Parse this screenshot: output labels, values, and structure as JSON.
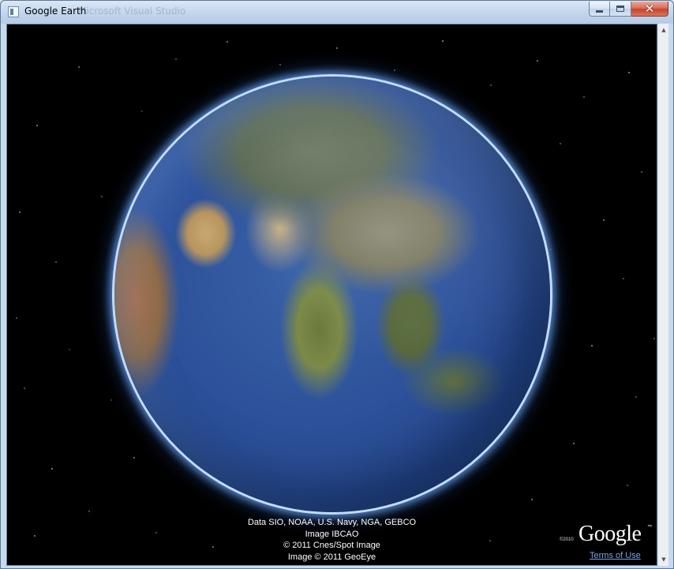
{
  "window": {
    "title": "Google Earth",
    "background_title": "Microsoft Visual Studio",
    "controls": {
      "minimize_icon": "minimize-icon",
      "maximize_icon": "maximize-icon",
      "close_icon": "close-icon",
      "close_glyph": "✕"
    }
  },
  "viewer": {
    "view": "globe centered on Asia and the Indian Ocean",
    "credits": [
      "Data SIO, NOAA, U.S. Navy, NGA, GEBCO",
      "Image IBCAO",
      "© 2011 Cnes/Spot Image",
      "Image © 2011 GeoEye"
    ],
    "brand": {
      "year": "©2010",
      "logo": "Google",
      "tm": "™"
    },
    "terms_link": "Terms of Use"
  },
  "scrollbar": {
    "up_glyph": "▲",
    "down_glyph": "▼"
  },
  "colors": {
    "space": "#000000",
    "ocean": "#2d519a",
    "atmosphere": "#6eaaff",
    "link": "#7da3e6"
  }
}
